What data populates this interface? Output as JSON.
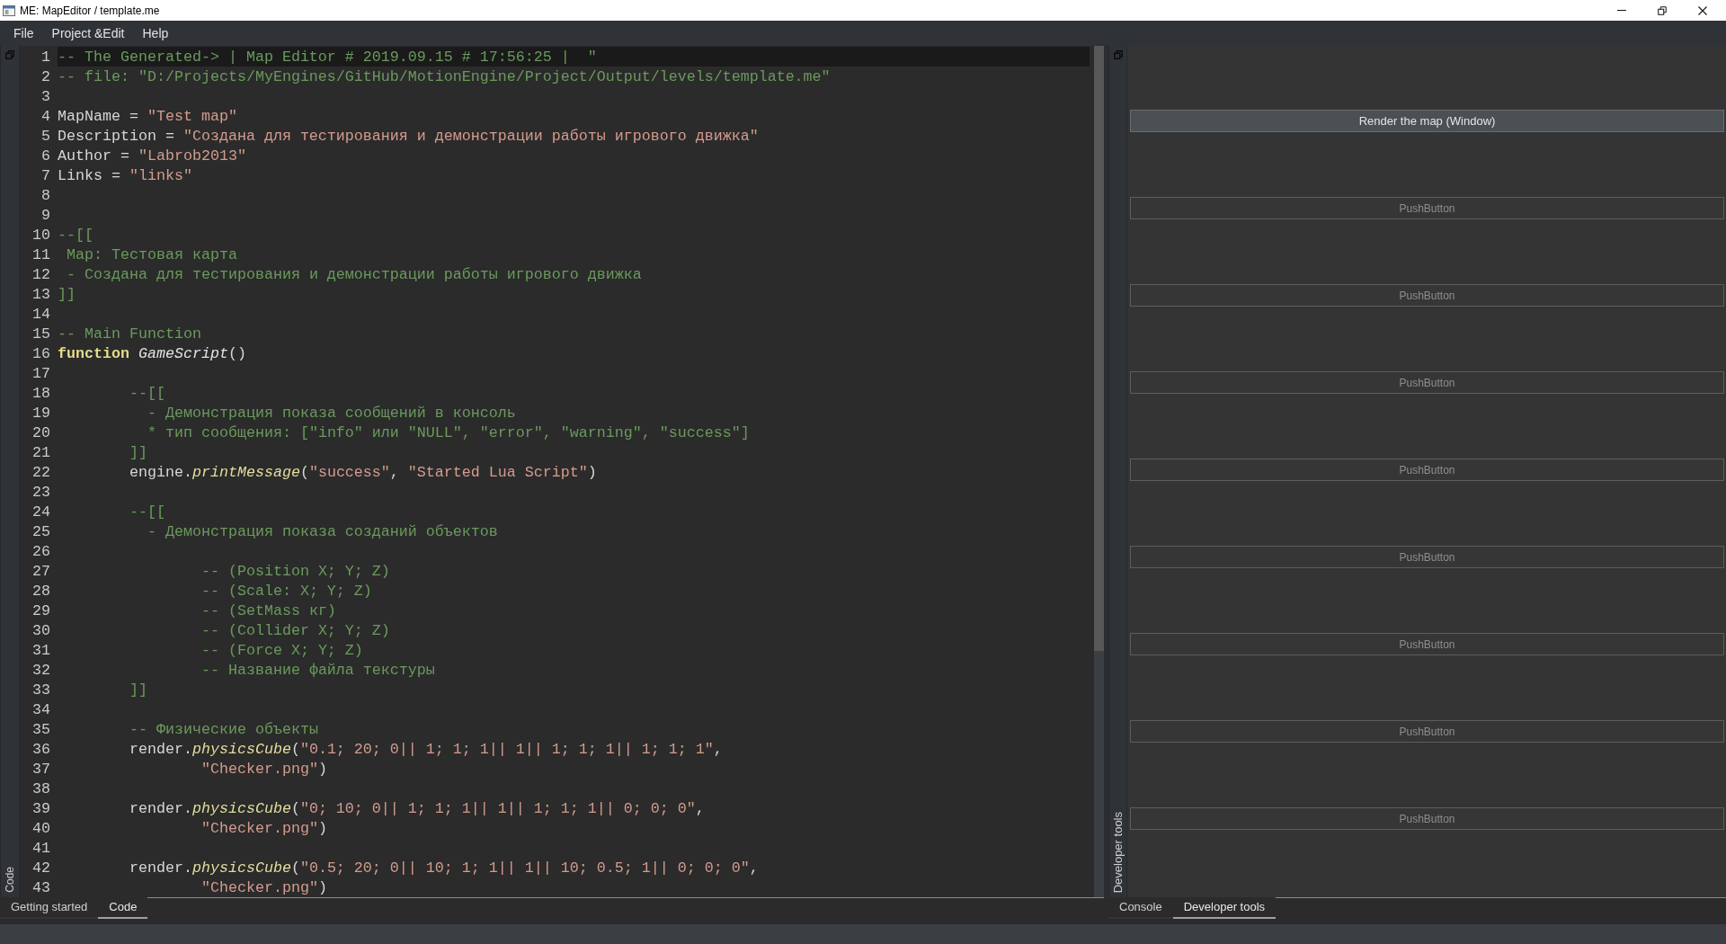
{
  "window": {
    "title": "ME: MapEditor / template.me"
  },
  "menu_bar": {
    "items": [
      "File",
      "Project &Edit",
      "Help"
    ]
  },
  "code_dock": {
    "title": "Code",
    "lines": [
      {
        "number": "1",
        "current": true,
        "tokens": [
          {
            "kind": "comment",
            "text": "-- The Generated-> | Map Editor # 2019.09.15 # 17:56:25 |  \""
          }
        ]
      },
      {
        "number": "2",
        "current": false,
        "tokens": [
          {
            "kind": "comment",
            "text": "-- file: \"D:/Projects/MyEngines/GitHub/MotionEngine/Project/Output/levels/template.me\""
          }
        ]
      },
      {
        "number": "3",
        "current": false
      },
      {
        "number": "4",
        "current": false,
        "tokens": [
          {
            "kind": "plain",
            "text": "MapName = "
          },
          {
            "kind": "string",
            "text": "\"Test map\""
          }
        ]
      },
      {
        "number": "5",
        "current": false,
        "tokens": [
          {
            "kind": "plain",
            "text": "Description = "
          },
          {
            "kind": "string",
            "text": "\"Создана для тестирования и демонстрации работы игрового движка\""
          }
        ]
      },
      {
        "number": "6",
        "current": false,
        "tokens": [
          {
            "kind": "plain",
            "text": "Author = "
          },
          {
            "kind": "string",
            "text": "\"Labrob2013\""
          }
        ]
      },
      {
        "number": "7",
        "current": false,
        "tokens": [
          {
            "kind": "plain",
            "text": "Links = "
          },
          {
            "kind": "string",
            "text": "\"links\""
          }
        ]
      },
      {
        "number": "8",
        "current": false
      },
      {
        "number": "9",
        "current": false
      },
      {
        "number": "10",
        "current": false,
        "tokens": [
          {
            "kind": "comment",
            "text": "--[["
          }
        ]
      },
      {
        "number": "11",
        "current": false,
        "tokens": [
          {
            "kind": "comment",
            "text": " Map: Тестовая карта"
          }
        ]
      },
      {
        "number": "12",
        "current": false,
        "tokens": [
          {
            "kind": "comment",
            "text": " - Создана для тестирования и демонстрации работы игрового движка"
          }
        ]
      },
      {
        "number": "13",
        "current": false,
        "tokens": [
          {
            "kind": "comment",
            "text": "]]"
          }
        ]
      },
      {
        "number": "14",
        "current": false
      },
      {
        "number": "15",
        "current": false,
        "tokens": [
          {
            "kind": "comment",
            "text": "-- Main Function"
          }
        ]
      },
      {
        "number": "16",
        "current": false,
        "tokens": [
          {
            "kind": "keyword",
            "text": "function "
          },
          {
            "kind": "name",
            "text": "GameScript"
          },
          {
            "kind": "plain",
            "text": "()"
          }
        ]
      },
      {
        "number": "17",
        "current": false
      },
      {
        "number": "18",
        "current": false,
        "tokens": [
          {
            "kind": "comment",
            "text": "        --[["
          }
        ]
      },
      {
        "number": "19",
        "current": false,
        "tokens": [
          {
            "kind": "comment",
            "text": "          - Демонстрация показа сообщений в консоль"
          }
        ]
      },
      {
        "number": "20",
        "current": false,
        "tokens": [
          {
            "kind": "comment",
            "text": "          * тип сообщения: [\"info\" или \"NULL\", \"error\", \"warning\", \"success\"]"
          }
        ]
      },
      {
        "number": "21",
        "current": false,
        "tokens": [
          {
            "kind": "comment",
            "text": "        ]]"
          }
        ]
      },
      {
        "number": "22",
        "current": false,
        "tokens": [
          {
            "kind": "plain",
            "text": "        engine."
          },
          {
            "kind": "call",
            "text": "printMessage"
          },
          {
            "kind": "plain",
            "text": "("
          },
          {
            "kind": "string",
            "text": "\"success\""
          },
          {
            "kind": "plain",
            "text": ", "
          },
          {
            "kind": "string",
            "text": "\"Started Lua Script\""
          },
          {
            "kind": "plain",
            "text": ")"
          }
        ]
      },
      {
        "number": "23",
        "current": false
      },
      {
        "number": "24",
        "current": false,
        "tokens": [
          {
            "kind": "comment",
            "text": "        --[["
          }
        ]
      },
      {
        "number": "25",
        "current": false,
        "tokens": [
          {
            "kind": "comment",
            "text": "          - Демонстрация показа созданий объектов"
          }
        ]
      },
      {
        "number": "26",
        "current": false
      },
      {
        "number": "27",
        "current": false,
        "tokens": [
          {
            "kind": "comment",
            "text": "                -- (Position X; Y; Z)"
          }
        ]
      },
      {
        "number": "28",
        "current": false,
        "tokens": [
          {
            "kind": "comment",
            "text": "                -- (Scale: X; Y; Z)"
          }
        ]
      },
      {
        "number": "29",
        "current": false,
        "tokens": [
          {
            "kind": "comment",
            "text": "                -- (SetMass кг)"
          }
        ]
      },
      {
        "number": "30",
        "current": false,
        "tokens": [
          {
            "kind": "comment",
            "text": "                -- (Collider X; Y; Z)"
          }
        ]
      },
      {
        "number": "31",
        "current": false,
        "tokens": [
          {
            "kind": "comment",
            "text": "                -- (Force X; Y; Z)"
          }
        ]
      },
      {
        "number": "32",
        "current": false,
        "tokens": [
          {
            "kind": "comment",
            "text": "                -- Название файла текстуры"
          }
        ]
      },
      {
        "number": "33",
        "current": false,
        "tokens": [
          {
            "kind": "comment",
            "text": "        ]]"
          }
        ]
      },
      {
        "number": "34",
        "current": false
      },
      {
        "number": "35",
        "current": false,
        "tokens": [
          {
            "kind": "comment",
            "text": "        -- Физические объекты"
          }
        ]
      },
      {
        "number": "36",
        "current": false,
        "tokens": [
          {
            "kind": "plain",
            "text": "        render."
          },
          {
            "kind": "call",
            "text": "physicsCube"
          },
          {
            "kind": "plain",
            "text": "("
          },
          {
            "kind": "string",
            "text": "\"0.1; 20; 0|| 1; 1; 1|| 1|| 1; 1; 1|| 1; 1; 1\""
          },
          {
            "kind": "plain",
            "text": ","
          }
        ]
      },
      {
        "number": "37",
        "current": false,
        "tokens": [
          {
            "kind": "string",
            "text": "                \"Checker.png\""
          },
          {
            "kind": "plain",
            "text": ")"
          }
        ]
      },
      {
        "number": "38",
        "current": false
      },
      {
        "number": "39",
        "current": false,
        "tokens": [
          {
            "kind": "plain",
            "text": "        render."
          },
          {
            "kind": "call",
            "text": "physicsCube"
          },
          {
            "kind": "plain",
            "text": "("
          },
          {
            "kind": "string",
            "text": "\"0; 10; 0|| 1; 1; 1|| 1|| 1; 1; 1|| 0; 0; 0\""
          },
          {
            "kind": "plain",
            "text": ","
          }
        ]
      },
      {
        "number": "40",
        "current": false,
        "tokens": [
          {
            "kind": "string",
            "text": "                \"Checker.png\""
          },
          {
            "kind": "plain",
            "text": ")"
          }
        ]
      },
      {
        "number": "41",
        "current": false
      },
      {
        "number": "42",
        "current": false,
        "tokens": [
          {
            "kind": "plain",
            "text": "        render."
          },
          {
            "kind": "call",
            "text": "physicsCube"
          },
          {
            "kind": "plain",
            "text": "("
          },
          {
            "kind": "string",
            "text": "\"0.5; 20; 0|| 10; 1; 1|| 1|| 10; 0.5; 1|| 0; 0; 0\""
          },
          {
            "kind": "plain",
            "text": ","
          }
        ]
      },
      {
        "number": "43",
        "current": false,
        "tokens": [
          {
            "kind": "string",
            "text": "                \"Checker.png\""
          },
          {
            "kind": "plain",
            "text": ")"
          }
        ]
      }
    ],
    "tabs": [
      {
        "label": "Getting started",
        "selected": false
      },
      {
        "label": "Code",
        "selected": true
      }
    ]
  },
  "tools_dock": {
    "title": "Developer tools",
    "buttons": [
      {
        "label": "Render the map (Window)",
        "disabled": false
      },
      {
        "label": "PushButton",
        "disabled": true
      },
      {
        "label": "PushButton",
        "disabled": true
      },
      {
        "label": "PushButton",
        "disabled": true
      },
      {
        "label": "PushButton",
        "disabled": true
      },
      {
        "label": "PushButton",
        "disabled": true
      },
      {
        "label": "PushButton",
        "disabled": true
      },
      {
        "label": "PushButton",
        "disabled": true
      },
      {
        "label": "PushButton",
        "disabled": true
      }
    ],
    "tabs": [
      {
        "label": "Console",
        "selected": false
      },
      {
        "label": "Developer tools",
        "selected": true
      }
    ]
  }
}
